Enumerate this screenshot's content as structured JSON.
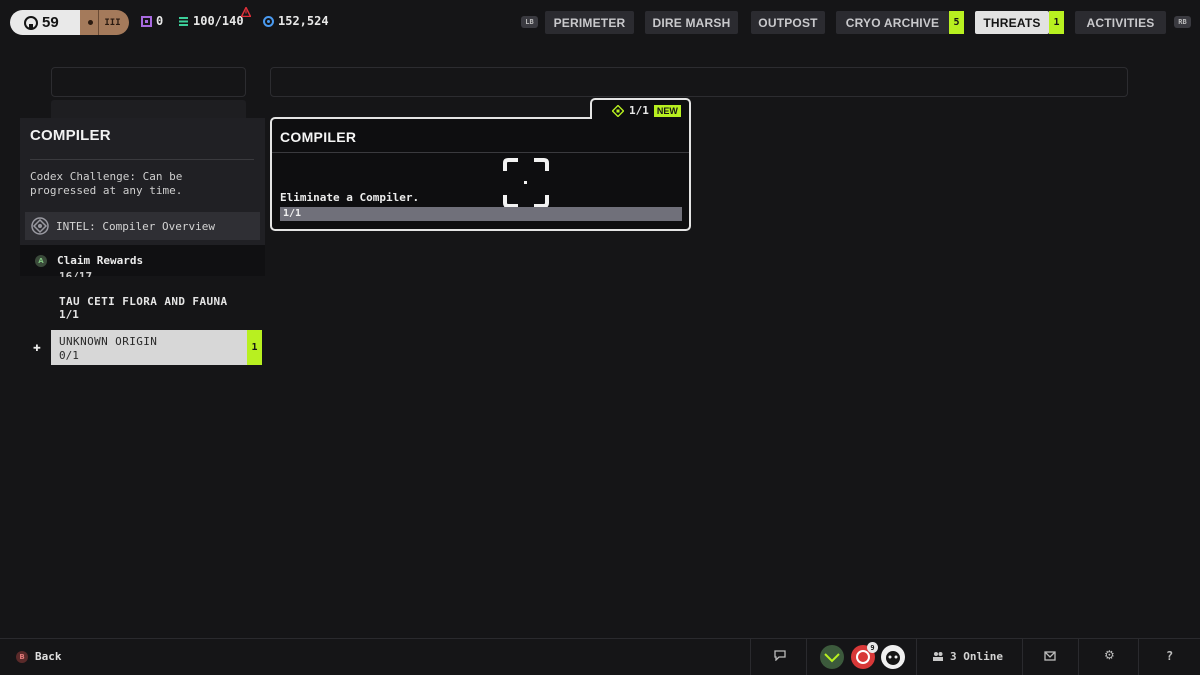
{
  "top_bar": {
    "level": "59",
    "rank": "III",
    "tokens": "0",
    "capacity": "100/140",
    "currency": "152,524",
    "left_shoulder": "LB",
    "right_shoulder": "RB",
    "tabs": [
      {
        "label": "PERIMETER",
        "badge": ""
      },
      {
        "label": "DIRE MARSH",
        "badge": ""
      },
      {
        "label": "OUTPOST",
        "badge": ""
      },
      {
        "label": "CRYO ARCHIVE",
        "badge": "5"
      },
      {
        "label": "THREATS",
        "badge": "1",
        "active": true
      },
      {
        "label": "ACTIVITIES",
        "badge": ""
      }
    ]
  },
  "popup": {
    "title": "COMPILER",
    "description": "Codex Challenge: Can be progressed at any time.",
    "intel_label": "INTEL: Compiler Overview",
    "claim_label": "Claim Rewards",
    "claim_button": "A"
  },
  "list": {
    "peek_text": "16/17",
    "items": [
      {
        "title": "TAU CETI FLORA AND FAUNA",
        "progress": "1/1"
      },
      {
        "title": "UNKNOWN ORIGIN",
        "progress": "0/1",
        "badge": "1",
        "selected": true
      }
    ]
  },
  "card": {
    "title": "COMPILER",
    "count": "1/1",
    "new_label": "NEW",
    "objective": "Eliminate a Compiler.",
    "progress_text": "1/1",
    "progress_fraction": 1.0
  },
  "bottom_bar": {
    "back_button": "B",
    "back_label": "Back",
    "online_label": "3 Online",
    "notification_count": "9"
  },
  "colors": {
    "accent": "#b8f020",
    "background": "#151517",
    "card_border": "#e4e4e4"
  },
  "icons": [
    "chat-icon",
    "mail-icon",
    "settings-icon",
    "help-icon",
    "friends-icon",
    "compiler-icon",
    "diamond-icon",
    "dpad-icon"
  ]
}
